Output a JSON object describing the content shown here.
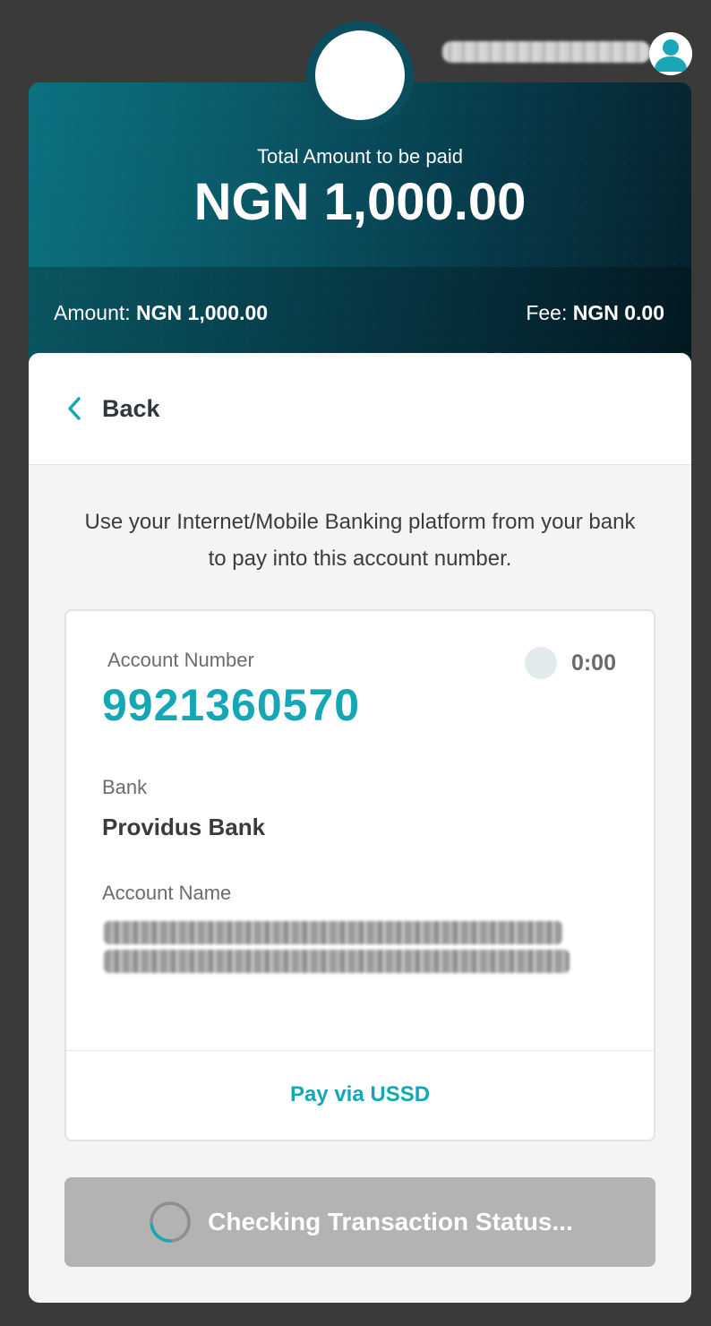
{
  "header": {
    "total_label": "Total Amount to be paid",
    "total_value": "NGN 1,000.00",
    "amount_label": "Amount:",
    "amount_value": "NGN 1,000.00",
    "fee_label": "Fee:",
    "fee_value": "NGN 0.00"
  },
  "user": {
    "avatar_icon": "user-avatar-icon",
    "name_redacted": true
  },
  "nav": {
    "back_label": "Back",
    "back_icon": "chevron-left-icon"
  },
  "instructions": "Use your Internet/Mobile Banking platform from your bank to pay into this account number.",
  "account": {
    "number_label": "Account Number",
    "number": "9921360570",
    "timer": "0:00",
    "bank_label": "Bank",
    "bank": "Providus Bank",
    "name_label": "Account Name",
    "name_redacted": true
  },
  "actions": {
    "ussd_label": "Pay via USSD",
    "status_label": "Checking Transaction Status..."
  },
  "colors": {
    "accent": "#15a7b6",
    "header_dark": "#073f4f",
    "page_background": "#3a3a3a",
    "button_disabled": "#b3b3b3"
  }
}
